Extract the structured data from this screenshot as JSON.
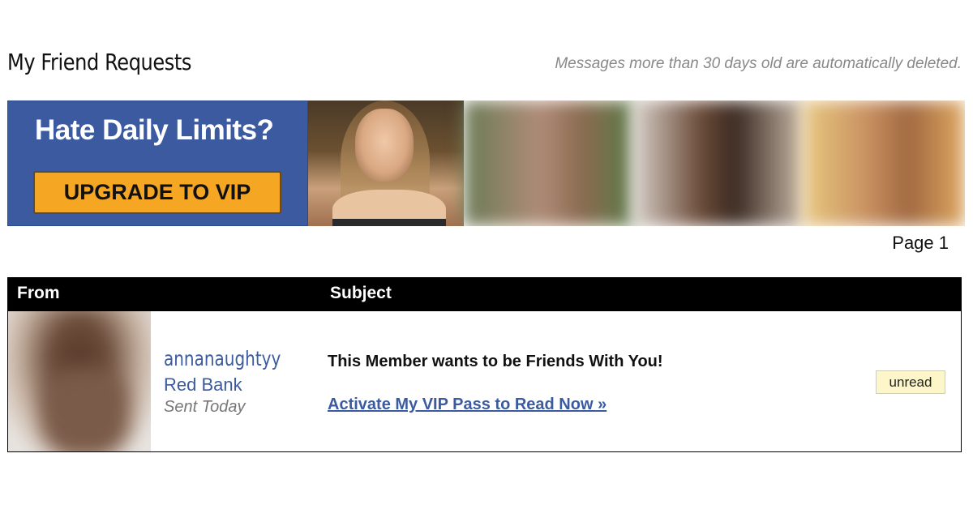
{
  "header": {
    "title": "My Friend Requests",
    "notice": "Messages more than 30 days old are automatically deleted."
  },
  "banner": {
    "headline": "Hate Daily Limits?",
    "button_label": "UPGRADE TO VIP"
  },
  "pagination": {
    "label": "Page 1"
  },
  "table": {
    "columns": [
      "From",
      "Subject"
    ],
    "rows": [
      {
        "username": "annanaughtyy",
        "location": "Red Bank",
        "sent": "Sent Today",
        "subject": "This Member wants to be Friends With You!",
        "link_text": "Activate My VIP Pass to Read Now »",
        "status": "unread"
      }
    ]
  },
  "colors": {
    "brand_blue": "#3b5aa0",
    "cta_orange": "#f5a623",
    "badge_bg": "#fdf6c8",
    "header_bg": "#000000"
  }
}
